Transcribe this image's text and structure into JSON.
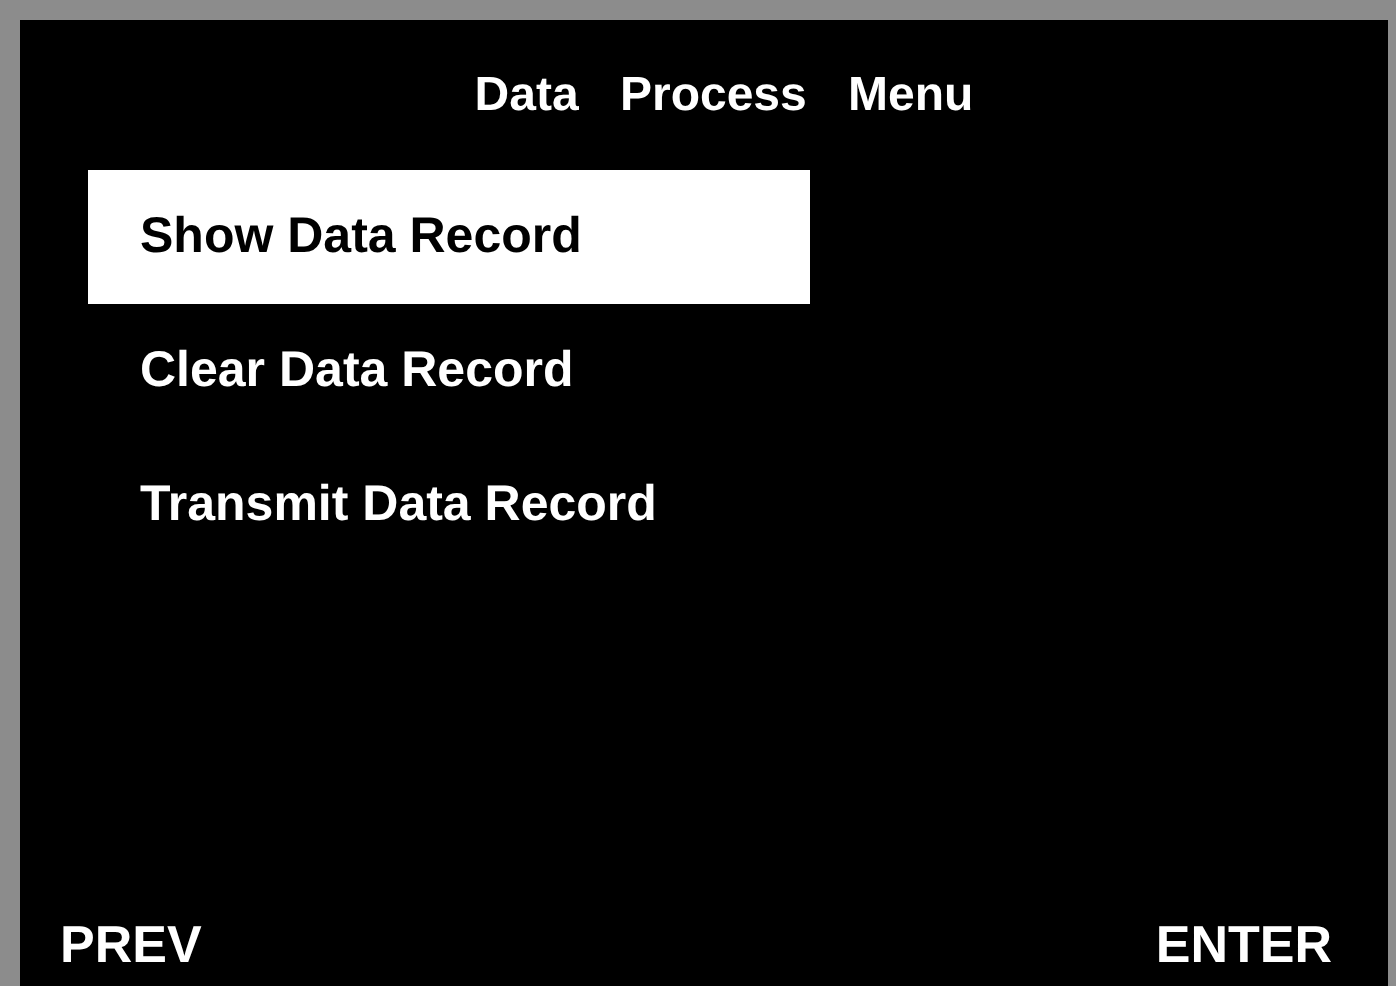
{
  "title": "Data Process Menu",
  "menu_items": [
    {
      "label": "Show Data Record",
      "selected": true
    },
    {
      "label": "Clear Data Record",
      "selected": false
    },
    {
      "label": "Transmit Data Record",
      "selected": false
    }
  ],
  "softkeys": {
    "left": "PREV",
    "right": "ENTER"
  }
}
